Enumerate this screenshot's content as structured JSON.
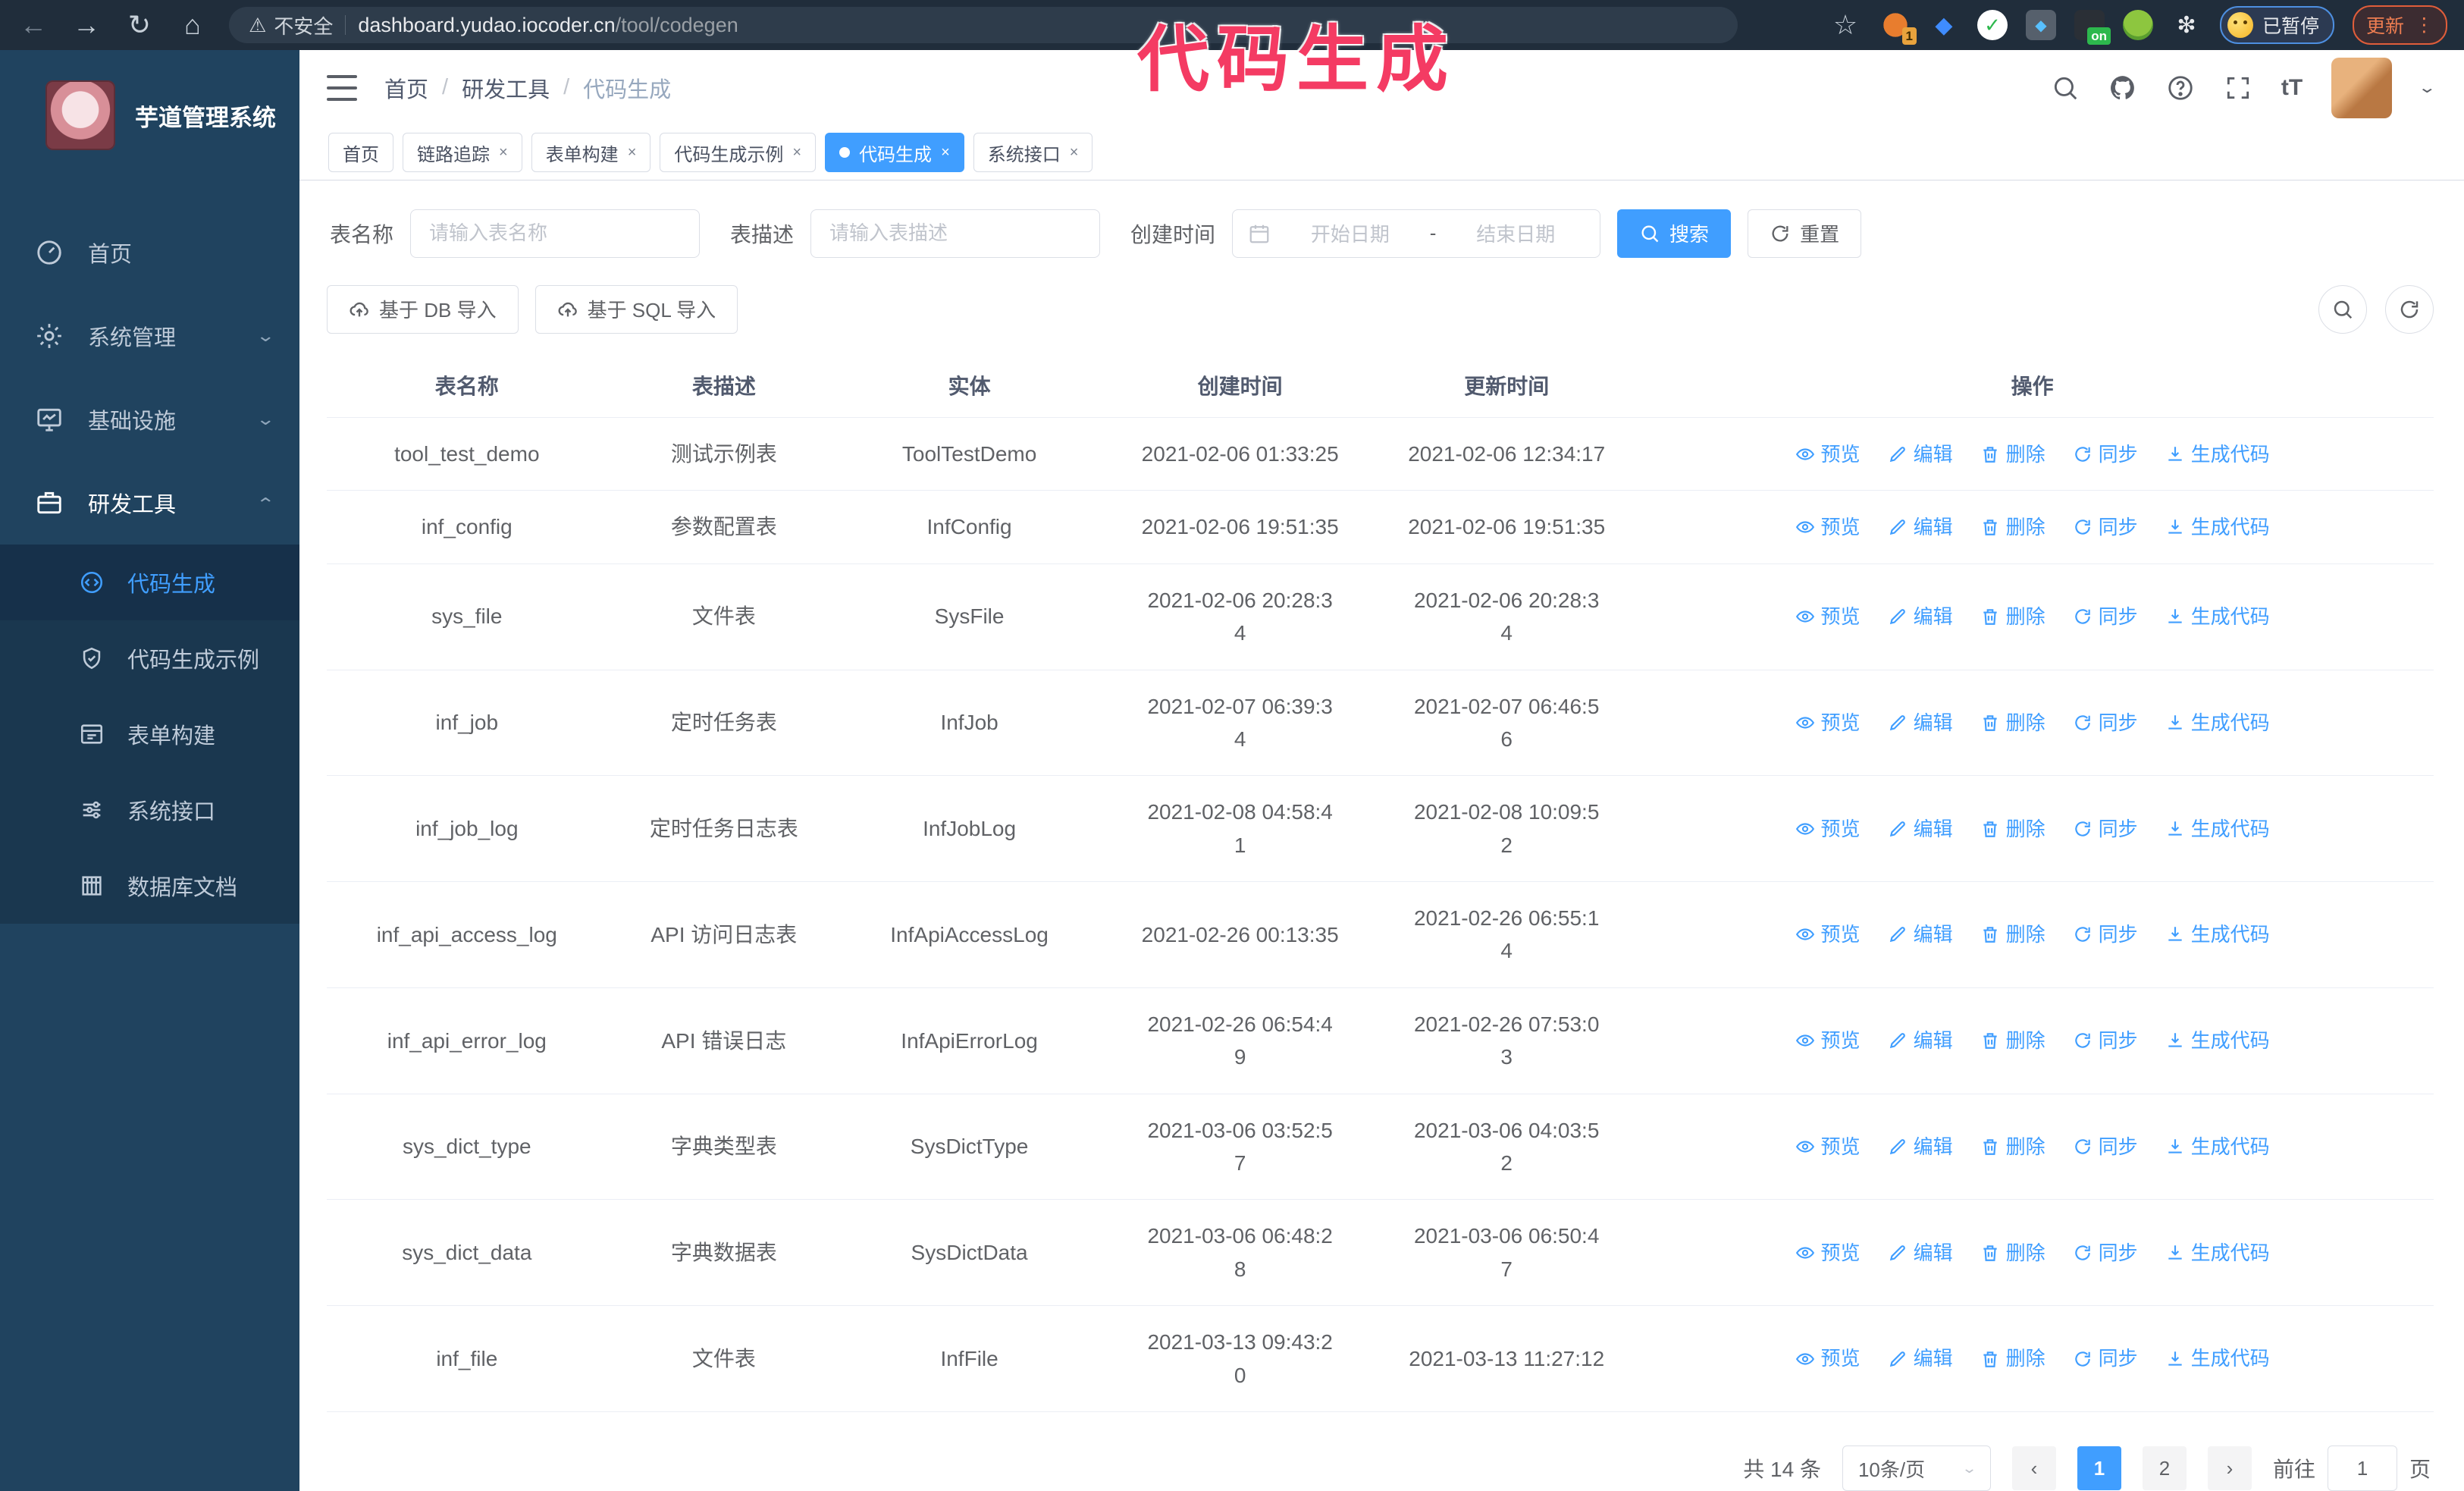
{
  "browser": {
    "security_warning": "不安全",
    "url_host": "dashboard.yudao.iocoder.cn",
    "url_path": "/tool/codegen",
    "ext_badge_1": "1",
    "ext_badge_on": "on",
    "paused_badge": "已暂停",
    "update_button": "更新"
  },
  "annotation": "代码生成",
  "colors": {
    "accent": "#409eff",
    "sidebar_bg": "#20435f",
    "submenu_bg": "#1a374f",
    "annotation_pink": "#f43b63",
    "toolbar_bg": "#202d3b",
    "update_orange": "#ee7d51"
  },
  "sidebar": {
    "title": "芋道管理系统",
    "items": [
      {
        "label": "首页"
      },
      {
        "label": "系统管理"
      },
      {
        "label": "基础设施"
      },
      {
        "label": "研发工具"
      }
    ],
    "subitems": [
      {
        "label": "代码生成",
        "active": true
      },
      {
        "label": "代码生成示例",
        "active": false
      },
      {
        "label": "表单构建",
        "active": false
      },
      {
        "label": "系统接口",
        "active": false
      },
      {
        "label": "数据库文档",
        "active": false
      }
    ]
  },
  "breadcrumb": [
    "首页",
    "研发工具",
    "代码生成"
  ],
  "tabs": [
    {
      "label": "首页",
      "closable": false,
      "active": false
    },
    {
      "label": "链路追踪",
      "closable": true,
      "active": false
    },
    {
      "label": "表单构建",
      "closable": true,
      "active": false
    },
    {
      "label": "代码生成示例",
      "closable": true,
      "active": false
    },
    {
      "label": "代码生成",
      "closable": true,
      "active": true
    },
    {
      "label": "系统接口",
      "closable": true,
      "active": false
    }
  ],
  "filters": {
    "name_label": "表名称",
    "name_placeholder": "请输入表名称",
    "desc_label": "表描述",
    "desc_placeholder": "请输入表描述",
    "time_label": "创建时间",
    "start_placeholder": "开始日期",
    "range_separator": "-",
    "end_placeholder": "结束日期",
    "search_label": "搜索",
    "reset_label": "重置"
  },
  "toolbar": {
    "import_db_label": "基于 DB 导入",
    "import_sql_label": "基于 SQL 导入"
  },
  "table": {
    "headers": [
      "表名称",
      "表描述",
      "实体",
      "创建时间",
      "更新时间",
      "操作"
    ],
    "action_labels": [
      "预览",
      "编辑",
      "删除",
      "同步",
      "生成代码"
    ],
    "rows": [
      {
        "name": "tool_test_demo",
        "desc": "测试示例表",
        "entity": "ToolTestDemo",
        "created": "2021-02-06 01:33:25",
        "updated": "2021-02-06 12:34:17"
      },
      {
        "name": "inf_config",
        "desc": "参数配置表",
        "entity": "InfConfig",
        "created": "2021-02-06 19:51:35",
        "updated": "2021-02-06 19:51:35"
      },
      {
        "name": "sys_file",
        "desc": "文件表",
        "entity": "SysFile",
        "created": "2021-02-06 20:28:3\n4",
        "updated": "2021-02-06 20:28:3\n4"
      },
      {
        "name": "inf_job",
        "desc": "定时任务表",
        "entity": "InfJob",
        "created": "2021-02-07 06:39:3\n4",
        "updated": "2021-02-07 06:46:5\n6"
      },
      {
        "name": "inf_job_log",
        "desc": "定时任务日志表",
        "entity": "InfJobLog",
        "created": "2021-02-08 04:58:4\n1",
        "updated": "2021-02-08 10:09:5\n2"
      },
      {
        "name": "inf_api_access_log",
        "desc": "API 访问日志表",
        "entity": "InfApiAccessLog",
        "created": "2021-02-26 00:13:35",
        "updated": "2021-02-26 06:55:1\n4"
      },
      {
        "name": "inf_api_error_log",
        "desc": "API 错误日志",
        "entity": "InfApiErrorLog",
        "created": "2021-02-26 06:54:4\n9",
        "updated": "2021-02-26 07:53:0\n3"
      },
      {
        "name": "sys_dict_type",
        "desc": "字典类型表",
        "entity": "SysDictType",
        "created": "2021-03-06 03:52:5\n7",
        "updated": "2021-03-06 04:03:5\n2"
      },
      {
        "name": "sys_dict_data",
        "desc": "字典数据表",
        "entity": "SysDictData",
        "created": "2021-03-06 06:48:2\n8",
        "updated": "2021-03-06 06:50:4\n7"
      },
      {
        "name": "inf_file",
        "desc": "文件表",
        "entity": "InfFile",
        "created": "2021-03-13 09:43:2\n0",
        "updated": "2021-03-13 11:27:12"
      }
    ]
  },
  "pagination": {
    "total": "共 14 条",
    "page_size": "10条/页",
    "pages": [
      "1",
      "2"
    ],
    "active_page": "1",
    "goto_label": "前往",
    "goto_value": "1",
    "goto_suffix": "页"
  }
}
